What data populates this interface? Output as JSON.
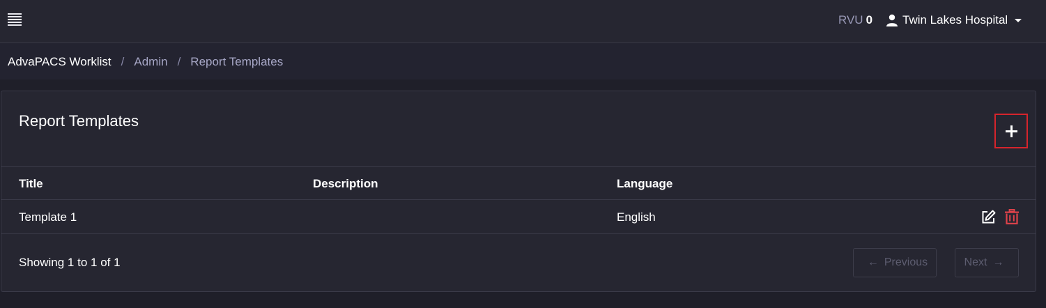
{
  "header": {
    "menu_icon": "hamburger-menu-icon",
    "rvu_label": "RVU",
    "rvu_value": "0",
    "user_icon": "user-icon",
    "user_name": "Twin Lakes Hospital",
    "dropdown_icon": "caret-down-icon"
  },
  "breadcrumb": {
    "items": [
      "AdvaPACS Worklist",
      "Admin",
      "Report Templates"
    ],
    "separator": "/"
  },
  "card": {
    "title": "Report Templates",
    "add_icon": "plus-icon"
  },
  "table": {
    "columns": [
      "Title",
      "Description",
      "Language"
    ],
    "rows": [
      {
        "title": "Template 1",
        "description": "",
        "language": "English",
        "actions": [
          "edit-icon",
          "trash-icon"
        ]
      }
    ]
  },
  "footer": {
    "info": "Showing 1 to 1 of 1",
    "prev_arrow": "←",
    "prev_label": "Previous",
    "next_label": "Next",
    "next_arrow": "→"
  },
  "colors": {
    "background": "#1f1f29",
    "panel": "#262631",
    "delete_red": "#e0434b",
    "highlight_red": "#d6242c"
  }
}
